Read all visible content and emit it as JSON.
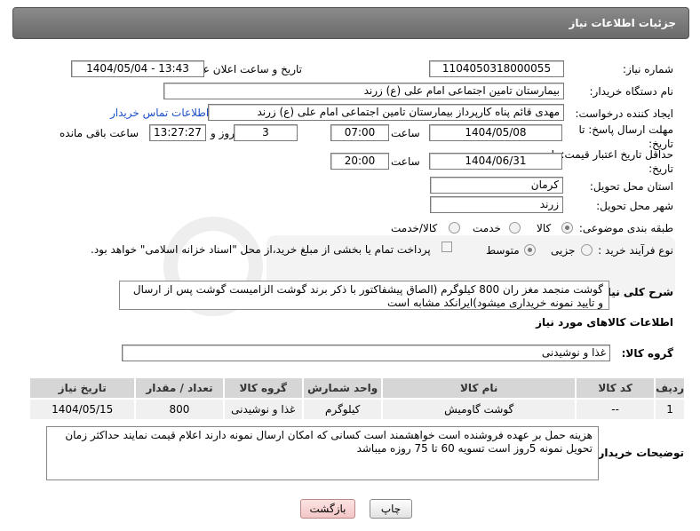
{
  "header": {
    "title": "جزئیات اطلاعات نیاز"
  },
  "fields": {
    "need_number_label": "شماره نیاز:",
    "need_number": "1104050318000055",
    "announce_label": "تاریخ و ساعت اعلان عمومی:",
    "announce_value": "1404/05/04 - 13:43",
    "buyer_org_label": "نام دستگاه خریدار:",
    "buyer_org": "بیمارستان تامین اجتماعی امام علی (ع) زرند",
    "creator_label": "ایجاد کننده درخواست:",
    "creator": "مهدی  قائم پناه  کارپرداز بیمارستان تامین اجتماعی امام علی (ع) زرند",
    "buyer_contact_link": "اطلاعات تماس خریدار",
    "reply_deadline_label": "مهلت ارسال پاسخ: تا تاریخ:",
    "reply_date": "1404/05/08",
    "time_label": "ساعت",
    "reply_time": "07:00",
    "days_value": "3",
    "days_label": "روز و",
    "remaining_time": "13:27:27",
    "remaining_label": "ساعت باقی مانده",
    "price_validity_label": "حداقل تاریخ اعتبار قیمت: تا تاریخ:",
    "validity_date": "1404/06/31",
    "validity_time": "20:00",
    "province_label": "استان محل تحویل:",
    "province": "کرمان",
    "city_label": "شهر محل تحویل:",
    "city": "زرند",
    "category_label": "طبقه بندی موضوعی:",
    "category_options": [
      "کالا",
      "خدمت",
      "کالا/خدمت"
    ],
    "process_label": "نوع فرآیند خرید :",
    "process_options": [
      "جزیی",
      "متوسط"
    ],
    "payment_note": "پرداخت تمام یا بخشی از مبلغ خرید،از محل \"اسناد خزانه اسلامی\" خواهد بود.",
    "summary_label": "شرح کلی نیاز:",
    "summary_text": "گوشت منجمد مغز ران 800 کیلوگرم (الصاق پیشفاکتور با ذکر برند گوشت الزامیست گوشت پس از ارسال و تایید نمونه خریداری میشود)ایرانکد مشابه است"
  },
  "goods_section": {
    "title": "اطلاعات کالاهای مورد نیاز",
    "group_label": "گروه کالا:",
    "group_value": "غذا و نوشیدنی"
  },
  "table": {
    "headers": [
      "ردیف",
      "کد کالا",
      "نام کالا",
      "واحد شمارش",
      "گروه کالا",
      "تعداد / مقدار",
      "تاریخ نیاز"
    ],
    "rows": [
      [
        "1",
        "--",
        "گوشت گاومیش",
        "کیلوگرم",
        "غذا و نوشیدنی",
        "800",
        "1404/05/15"
      ]
    ]
  },
  "buyer_notes": {
    "label": "توضیحات خریدار:",
    "text": "هزینه حمل بر عهده فروشنده است خواهشمند است کسانی که امکان ارسال نمونه دارند اعلام قیمت نمایند حداکثر زمان تحویل نمونه 5روز است تسویه 60 تا 75 روزه میباشد"
  },
  "buttons": {
    "print": "چاپ",
    "back": "بازگشت"
  },
  "colors": {
    "header_bg": "#7a7a7a",
    "link": "#1a4fc9",
    "table_header": "#d6d6d6"
  }
}
